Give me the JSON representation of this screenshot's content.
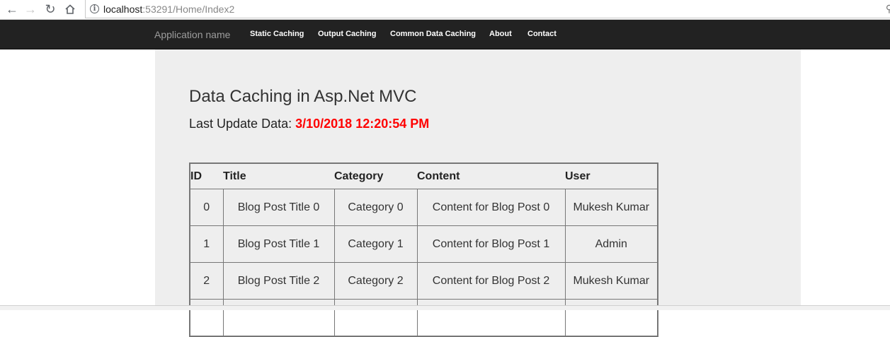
{
  "browser": {
    "url_host": "localhost",
    "url_rest": ":53291/Home/Index2"
  },
  "navbar": {
    "brand": "Application name",
    "items": [
      "Static Caching",
      "Output Caching",
      "Common Data Caching",
      "About",
      "Contact"
    ]
  },
  "main": {
    "title": "Data Caching in Asp.Net MVC",
    "last_update_label": "Last Update Data:",
    "last_update_value": "3/10/2018 12:20:54 PM"
  },
  "table": {
    "headers": [
      "ID",
      "Title",
      "Category",
      "Content",
      "User"
    ],
    "rows": [
      [
        "0",
        "Blog Post Title 0",
        "Category 0",
        "Content for Blog Post 0",
        "Mukesh Kumar"
      ],
      [
        "1",
        "Blog Post Title 1",
        "Category 1",
        "Content for Blog Post 1",
        "Admin"
      ],
      [
        "2",
        "Blog Post Title 2",
        "Category 2",
        "Content for Blog Post 2",
        "Mukesh Kumar"
      ]
    ]
  },
  "colors": {
    "navbar_bg": "#222222",
    "jumbotron_bg": "#eeeeee",
    "timestamp": "#ff0000"
  }
}
